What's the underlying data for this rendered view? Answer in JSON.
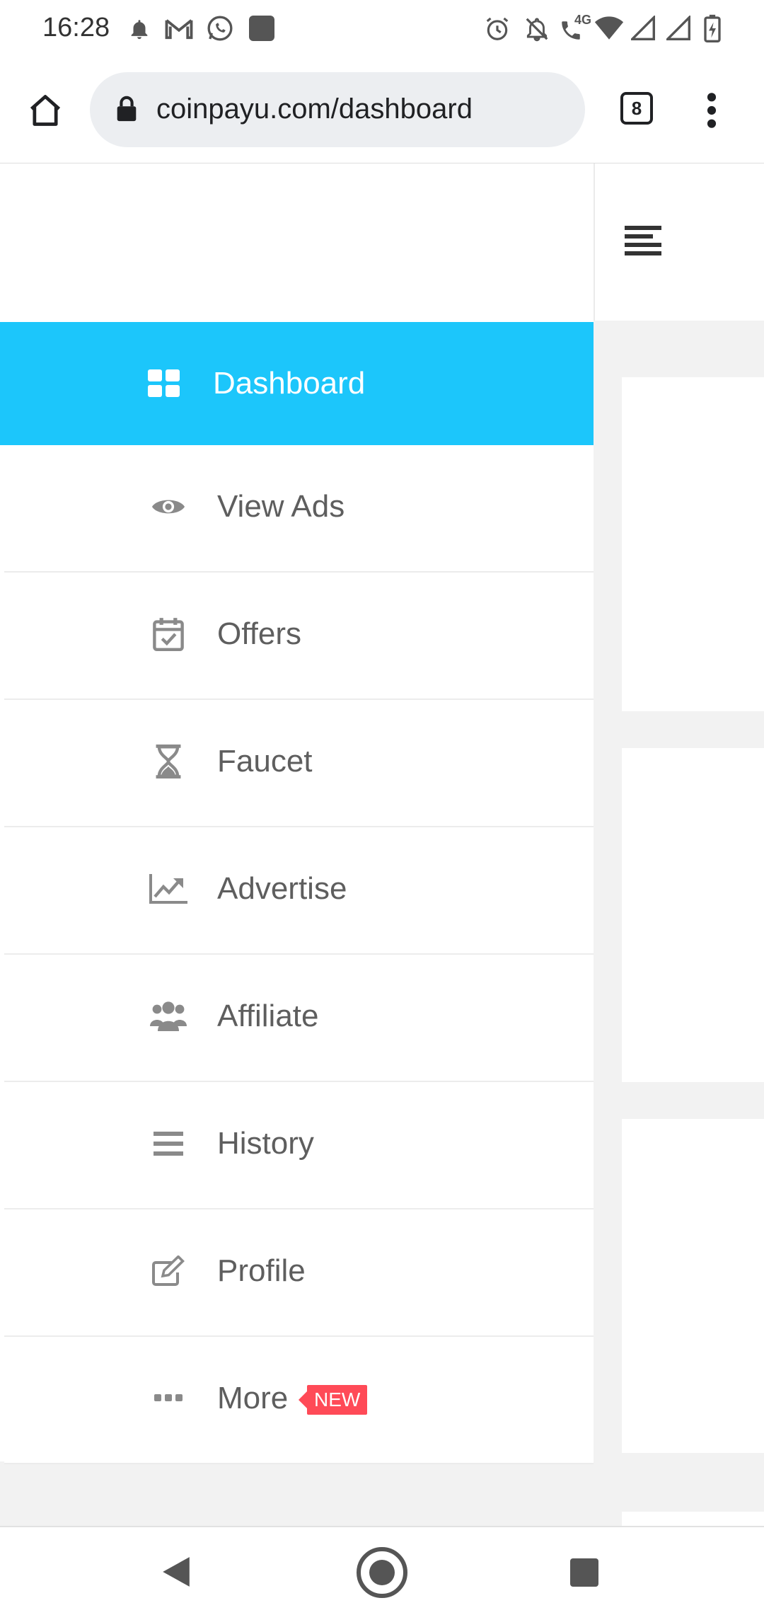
{
  "status_bar": {
    "time": "16:28",
    "left_icons": [
      "notification-bell-icon",
      "gmail-icon",
      "whatsapp-icon",
      "app-square-icon"
    ],
    "right_icons": [
      "alarm-icon",
      "notifications-off-icon",
      "volte-call-icon",
      "wifi-icon",
      "cell-signal-icon",
      "cell-signal-2-icon",
      "battery-charging-icon"
    ],
    "volte_label": "4G"
  },
  "browser": {
    "url": "coinpayu.com/dashboard",
    "tab_count": "8",
    "icons": [
      "home-icon",
      "lock-icon",
      "tabs-icon",
      "more-vert-icon"
    ]
  },
  "sidebar": {
    "items": [
      {
        "label": "Dashboard",
        "icon": "dashboard-grid-icon",
        "active": true
      },
      {
        "label": "View Ads",
        "icon": "eye-icon",
        "active": false
      },
      {
        "label": "Offers",
        "icon": "calendar-check-icon",
        "active": false
      },
      {
        "label": "Faucet",
        "icon": "hourglass-icon",
        "active": false
      },
      {
        "label": "Advertise",
        "icon": "chart-line-icon",
        "active": false
      },
      {
        "label": "Affiliate",
        "icon": "users-icon",
        "active": false
      },
      {
        "label": "History",
        "icon": "list-icon",
        "active": false
      },
      {
        "label": "Profile",
        "icon": "edit-icon",
        "active": false
      },
      {
        "label": "More",
        "icon": "ellipsis-icon",
        "active": false,
        "badge": "NEW"
      }
    ]
  },
  "colors": {
    "active_bg": "#1cc6fb",
    "badge_bg": "#ff4a57",
    "icon_gray": "#8a8a8a",
    "label_gray": "#5e5e5e"
  },
  "android_nav": {
    "icons": [
      "back-icon",
      "home-circle-icon",
      "recents-icon"
    ]
  }
}
